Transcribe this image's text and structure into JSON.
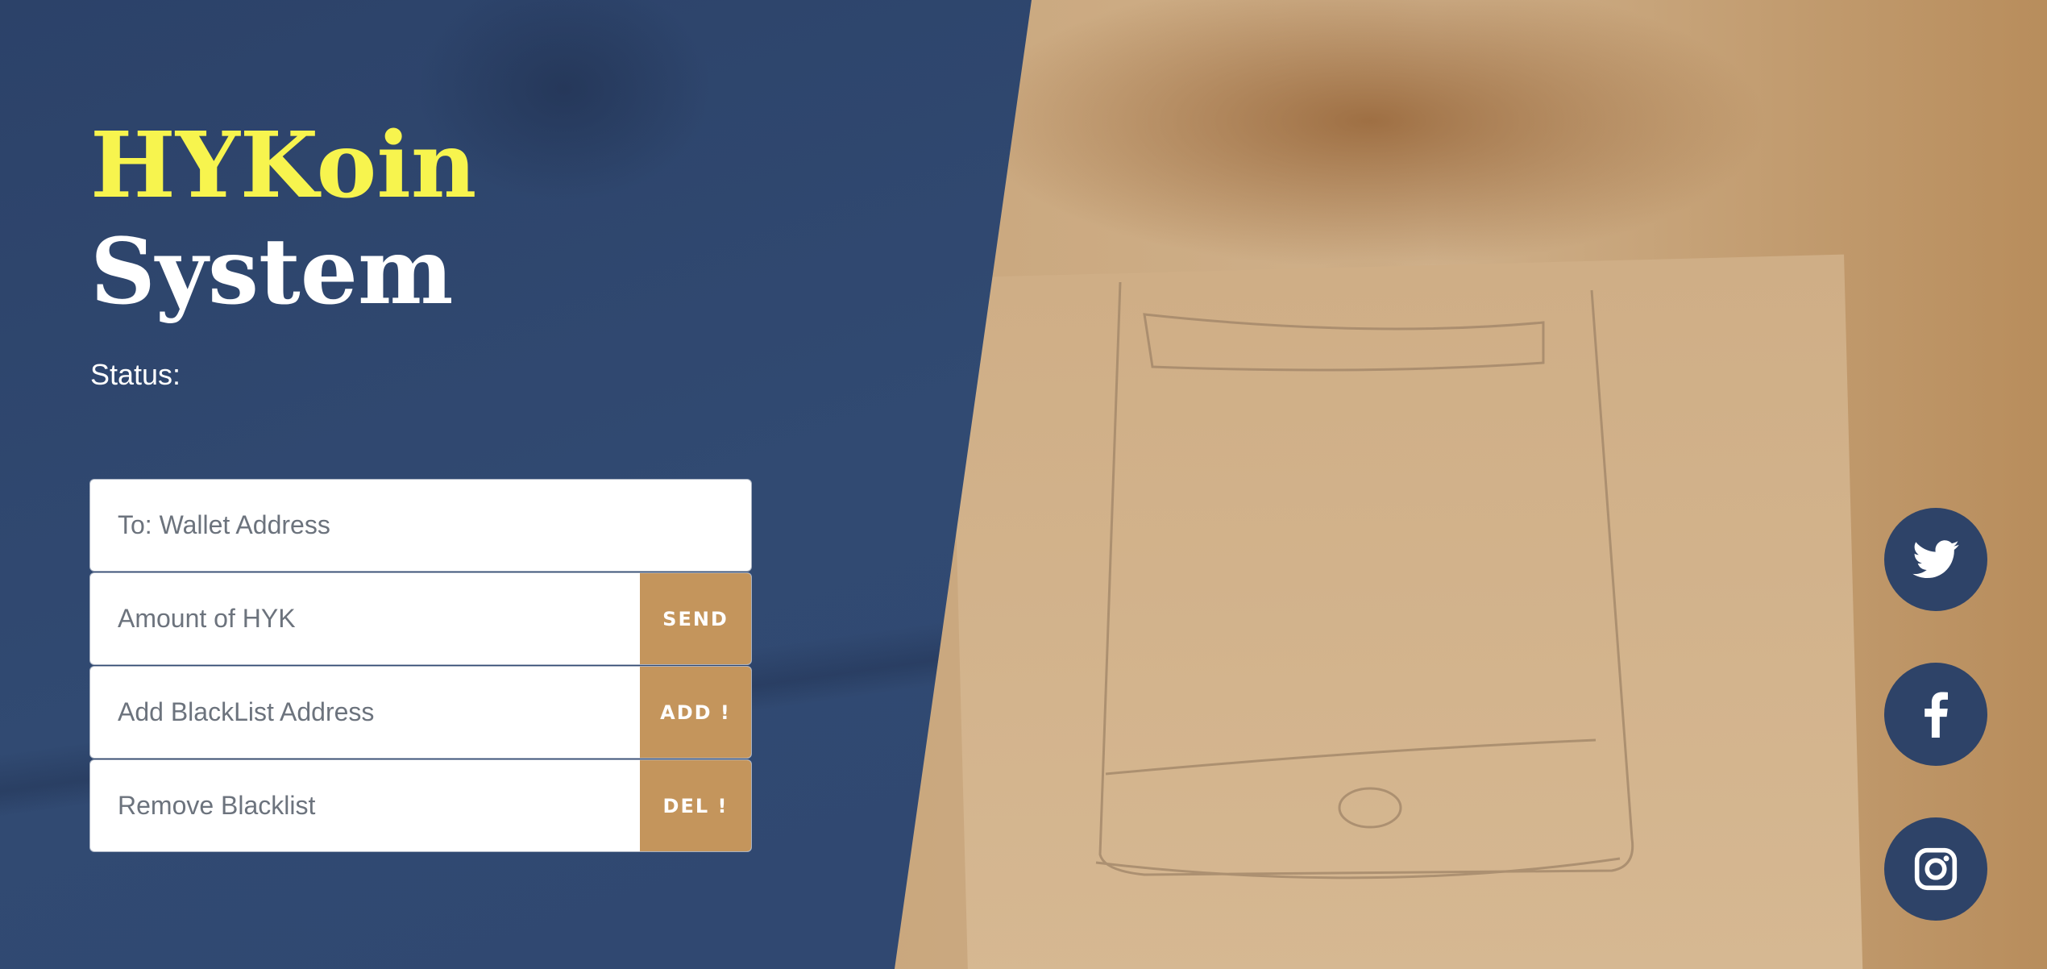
{
  "brand": {
    "title_line1": "HYKoin",
    "title_line2": "System"
  },
  "status": {
    "label": "Status:"
  },
  "form": {
    "wallet_placeholder": "To: Wallet Address",
    "amount_placeholder": "Amount of HYK",
    "send_label": "SEND",
    "blacklist_add_placeholder": "Add BlackList Address",
    "add_label": "ADD !",
    "blacklist_remove_placeholder": "Remove Blacklist",
    "del_label": "DEL !"
  },
  "social": {
    "icons": [
      "twitter-icon",
      "facebook-icon",
      "instagram-icon"
    ]
  },
  "colors": {
    "accent_yellow": "#f7f44e",
    "panel_navy": "#2f4670",
    "button_tan": "#c4955c",
    "social_bg": "#2e4368"
  }
}
